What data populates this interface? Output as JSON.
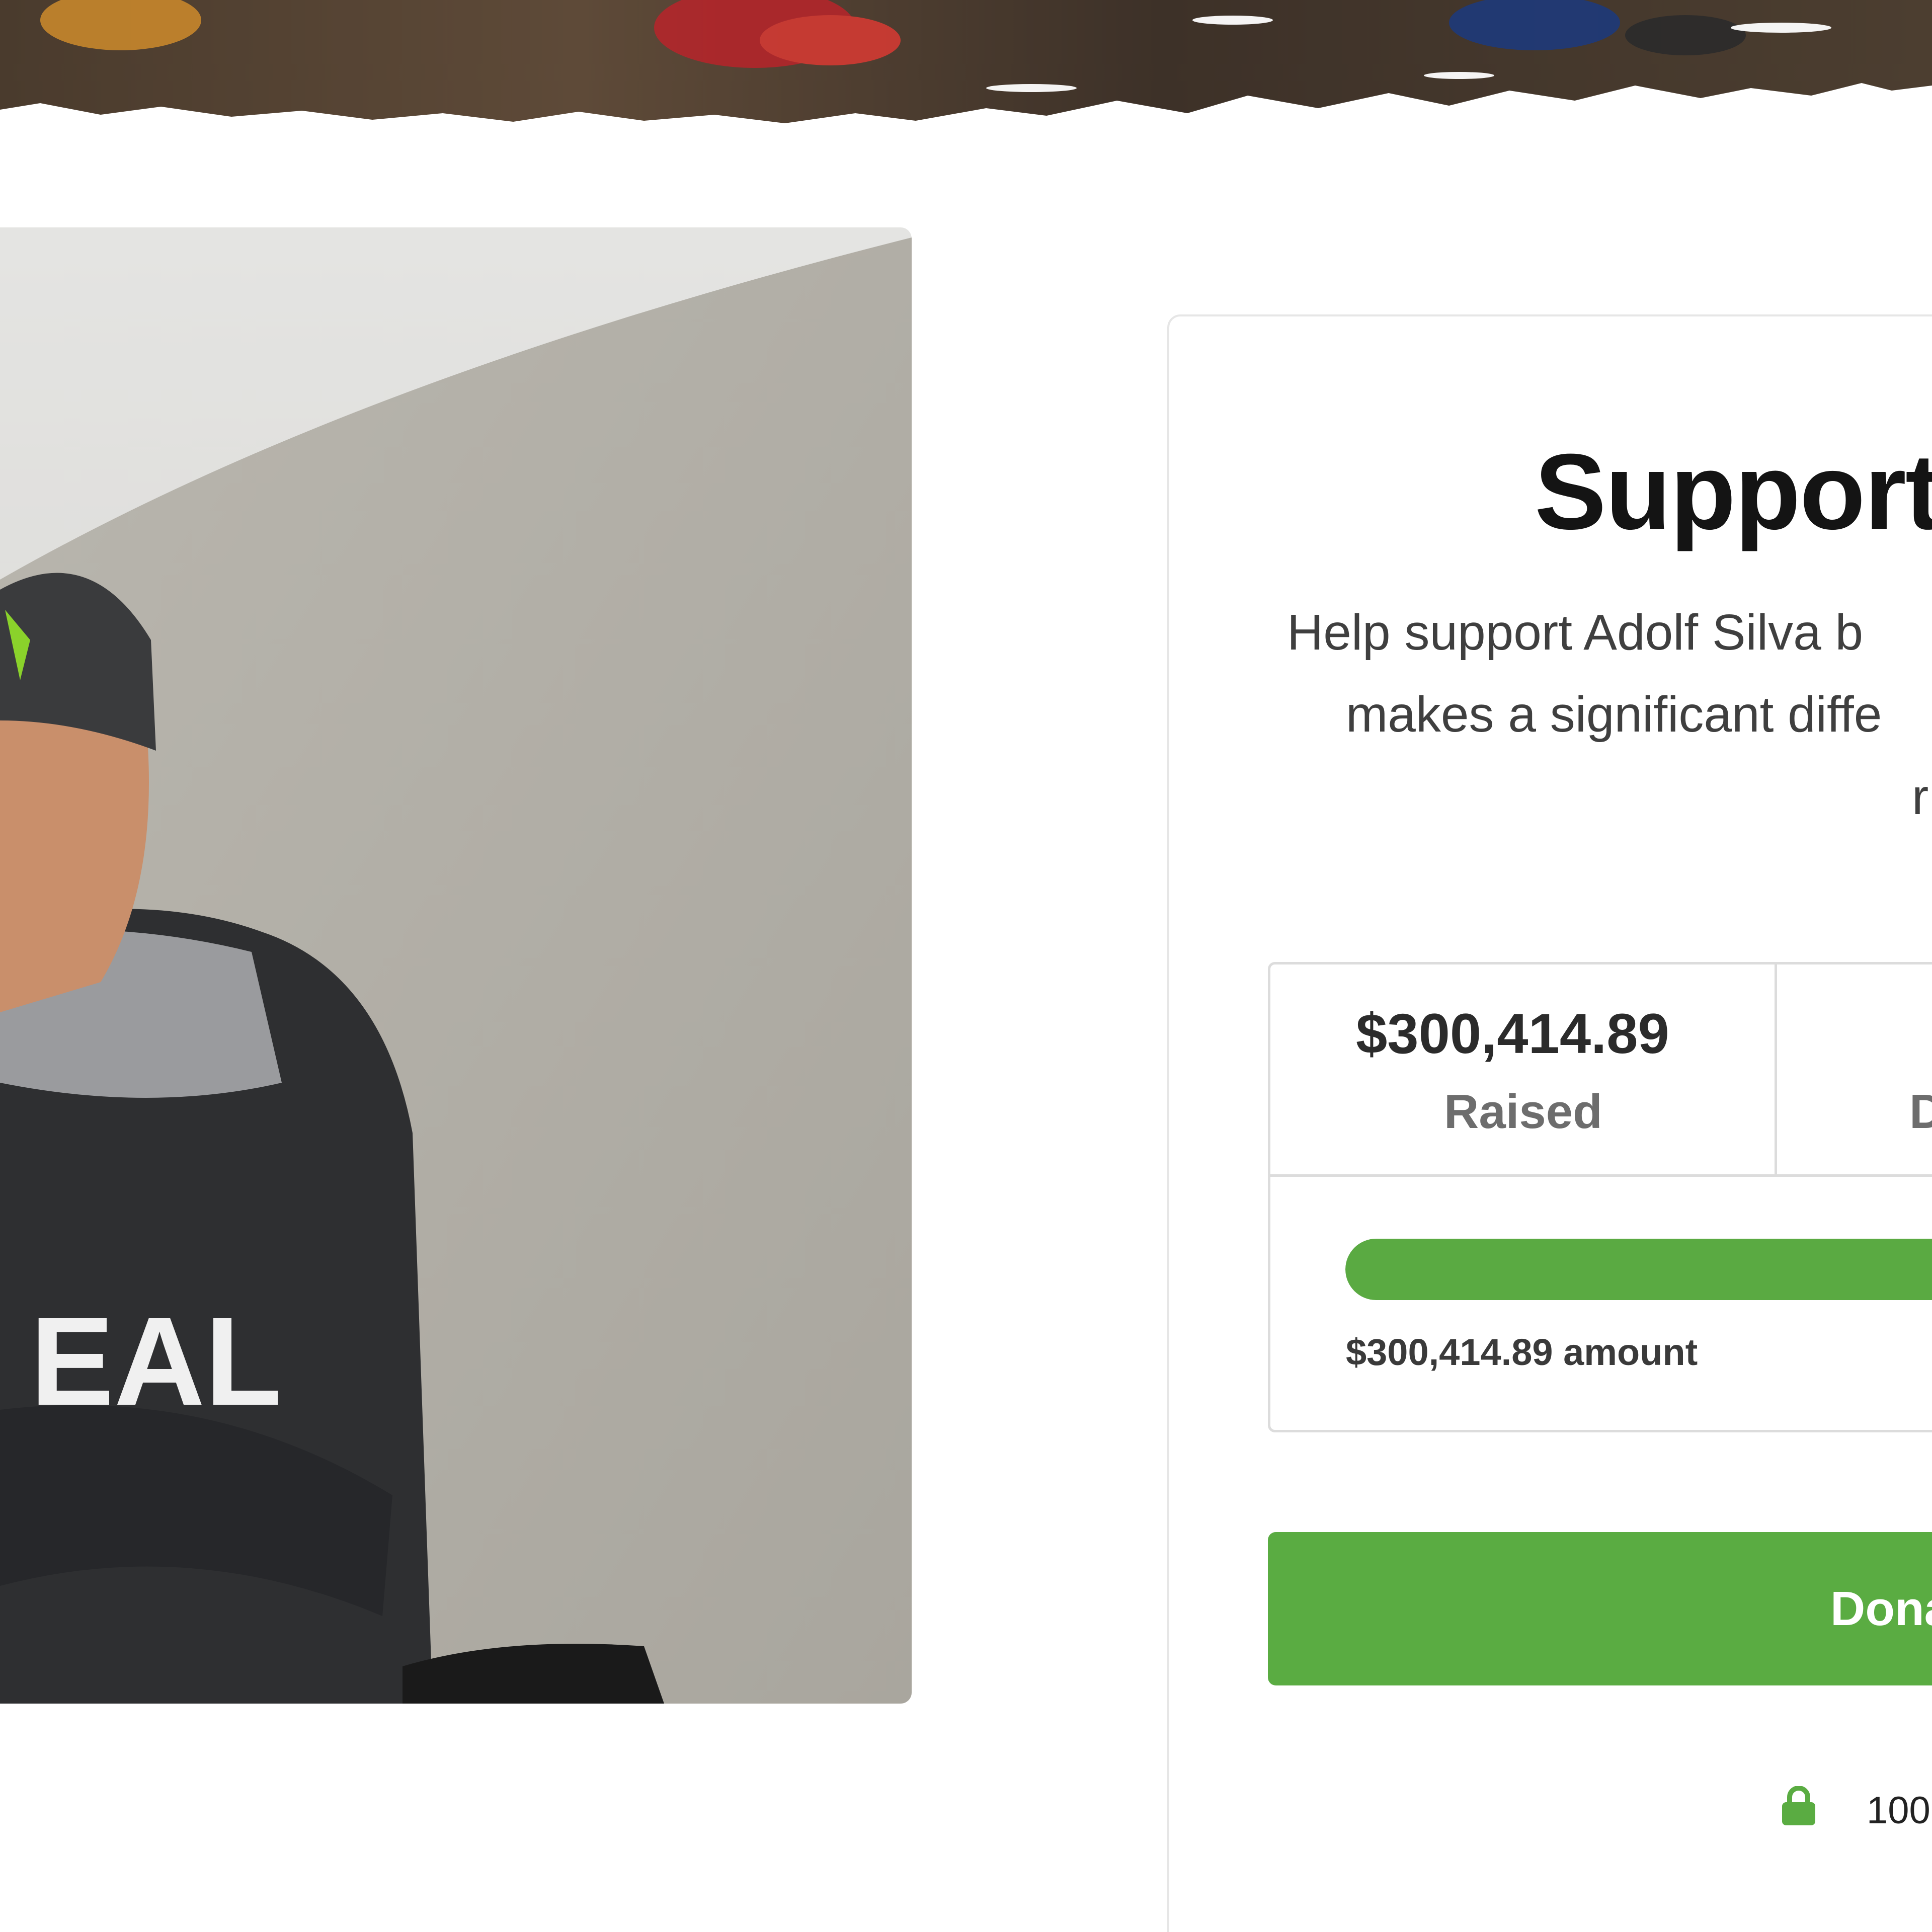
{
  "colors": {
    "accent_green": "#5aac42",
    "text_dark": "#141414",
    "text_muted": "#6d6d6d",
    "border": "#dcdcdc"
  },
  "card": {
    "title": "Support",
    "description_lines": [
      "Help support Adolf Silva b",
      "makes a significant diffe",
      "r"
    ]
  },
  "stats": {
    "raised_amount": "$300,414.89",
    "raised_label": "Raised",
    "donors_label": "D"
  },
  "progress": {
    "fill_percent": 100,
    "amount_text": "$300,414.89 amount"
  },
  "donate_button": {
    "label": "Dona"
  },
  "secure": {
    "icon": "lock-icon",
    "text": "100"
  }
}
